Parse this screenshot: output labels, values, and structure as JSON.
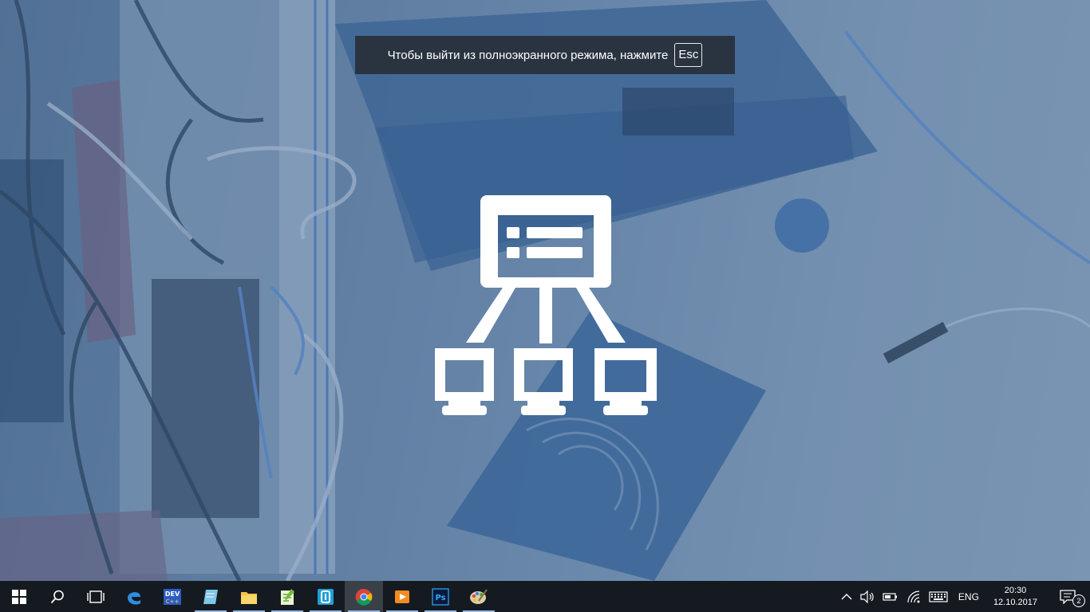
{
  "toast": {
    "message": "Чтобы выйти из полноэкранного режима, нажмите",
    "key": "Esc"
  },
  "center_icon": "network-server-icon",
  "taskbar": {
    "items": [
      {
        "name": "start-button",
        "icon": "windows-logo-icon"
      },
      {
        "name": "search-button",
        "icon": "search-icon"
      },
      {
        "name": "task-view-button",
        "icon": "task-view-icon"
      },
      {
        "name": "edge-app",
        "icon": "edge-icon"
      },
      {
        "name": "devcpp-app",
        "icon": "devcpp-icon"
      },
      {
        "name": "notepad-app",
        "icon": "notepad-icon",
        "running": true
      },
      {
        "name": "file-explorer-app",
        "icon": "folder-icon",
        "running": true
      },
      {
        "name": "notepadpp-app",
        "icon": "notepadpp-icon",
        "running": true
      },
      {
        "name": "arduino-app",
        "icon": "arduino-icon",
        "running": true
      },
      {
        "name": "chrome-app",
        "icon": "chrome-icon",
        "running": true,
        "active": true
      },
      {
        "name": "media-player-app",
        "icon": "media-player-icon",
        "running": true
      },
      {
        "name": "photoshop-app",
        "icon": "photoshop-icon",
        "running": true
      },
      {
        "name": "paint-app",
        "icon": "paint-icon",
        "running": true
      }
    ],
    "tray": {
      "language": "ENG",
      "time": "20:30",
      "date": "12.10.2017",
      "notifications_count": "2"
    }
  },
  "colors": {
    "taskbar_bg": "#151a21",
    "running_indicator": "#8fb8e6",
    "toast_bg": "#28303a"
  }
}
